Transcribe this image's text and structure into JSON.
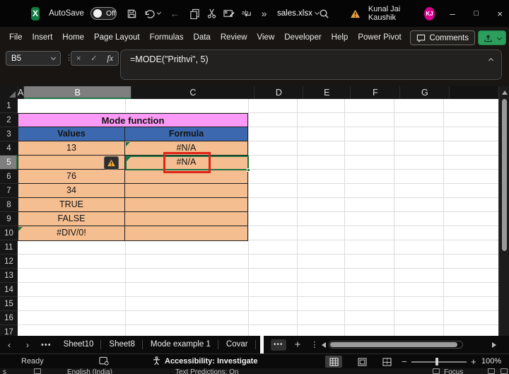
{
  "titlebar": {
    "autosave_label": "AutoSave",
    "autosave_state": "Off",
    "filename": "sales.xlsx",
    "more_commands": "»",
    "user_name": "Kunal Jai Kaushik",
    "user_initials": "KJ",
    "minimize": "–",
    "maximize": "□",
    "close": "×"
  },
  "ribbon": {
    "tabs": [
      "File",
      "Insert",
      "Home",
      "Page Layout",
      "Formulas",
      "Data",
      "Review",
      "View",
      "Developer",
      "Help",
      "Power Pivot"
    ],
    "comments_label": "Comments"
  },
  "formula_bar": {
    "cell_reference": "B5",
    "cancel_glyph": "×",
    "enter_glyph": "✓",
    "fx_label": "fx",
    "formula": "=MODE(\"Prithvi\", 5)"
  },
  "grid": {
    "column_headers": [
      "A",
      "B",
      "C",
      "D",
      "E",
      "F",
      "G"
    ],
    "row_numbers": [
      "1",
      "2",
      "3",
      "4",
      "5",
      "6",
      "7",
      "8",
      "9",
      "10",
      "11",
      "12",
      "13",
      "14",
      "15",
      "16",
      "17"
    ],
    "active_column": "B",
    "active_row": "5",
    "table": {
      "title": "Mode function",
      "col1_header": "Values",
      "col2_header": "Formula",
      "rows": [
        {
          "value": "13",
          "formula": "#N/A"
        },
        {
          "value": "",
          "formula": "#N/A"
        },
        {
          "value": "76",
          "formula": ""
        },
        {
          "value": "34",
          "formula": ""
        },
        {
          "value": "TRUE",
          "formula": ""
        },
        {
          "value": "FALSE",
          "formula": ""
        },
        {
          "value": "#DIV/0!",
          "formula": ""
        }
      ]
    }
  },
  "sheet_bar": {
    "tabs": [
      "Sheet10",
      "Sheet8",
      "Mode example 1",
      "Covar"
    ],
    "more_glyph": "•••",
    "add_sheet_glyph": "+",
    "kebab_glyph": "⋮",
    "prev_glyph": "‹",
    "next_glyph": "›"
  },
  "status_bar": {
    "mode": "Ready",
    "accessibility": "Accessibility: Investigate",
    "zoom_out": "−",
    "zoom_in": "+",
    "zoom_level": "100%"
  },
  "bottom_strip": {
    "partial_left": "s",
    "language": "English (India)",
    "predictions": "Text Predictions: On",
    "focus": "Focus"
  },
  "colors": {
    "accent_green": "#107C41",
    "selection_green": "#1E7145",
    "annotation_red": "#E02417",
    "table_title_bg": "#FB9AF6",
    "table_header_bg": "#3B68AE",
    "table_cell_bg": "#F5BE90",
    "avatar_bg": "#D7008F",
    "share_button_bg": "#2E9E5F",
    "warning_orange": "#E8A33D"
  }
}
